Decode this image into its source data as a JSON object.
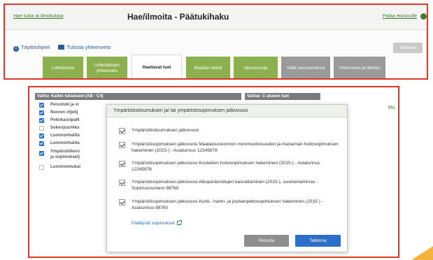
{
  "header": {
    "left_link": "Hae tukia ja ilmoituksia",
    "title": "Hae/ilmoita - Päätukihaku",
    "right_link": "Palaa etusivulle"
  },
  "toolbar": {
    "help_label": "Täyttöohjeet",
    "print_label": "Tulosta yhteenveto",
    "save_label": "Tallenna"
  },
  "tabs": [
    {
      "label": "Lohkotiedot"
    },
    {
      "label": "Lohkotietojen yhteenveto"
    },
    {
      "label": "Haettavat tuet"
    },
    {
      "label": "Maatilan tiedot"
    },
    {
      "label": "Vipuneuvoja"
    },
    {
      "label": "Vältä seuraamuksia"
    },
    {
      "label": "Yhteenveto ja lähetys"
    }
  ],
  "table": {
    "col_select": "Valitse",
    "col_all": "Kaikki tukialueet (AB - C4)",
    "col_select2": "Valitse",
    "col_c": "C-alueen tuet",
    "rows": [
      {
        "label": "Perustuki ja vi",
        "checked": true
      },
      {
        "label": "Nuoren viljelij",
        "checked": true
      },
      {
        "label": "Peltokasvipalk",
        "checked": true
      },
      {
        "label": "Sokerijuurikka",
        "checked": false
      },
      {
        "label": "Luonnonhaitta",
        "checked": true
      },
      {
        "label": "Luonnonhaitta",
        "checked": true
      },
      {
        "label": "Ympäristökorv",
        "label2": "ja sopimukset)",
        "checked": true
      },
      {
        "label": "Luonnonmukai",
        "checked": false
      }
    ],
    "right_partial": "Mu"
  },
  "modal": {
    "title": "Ympäristösitoumuksen ja/ tai ympäristösopimuksen jatkovuosi",
    "items": [
      {
        "text": "Ympäristösitoumuksen jatkovuosi"
      },
      {
        "text": "Ympäristösopimuksen jatkovuosi Maatalousluonnon monimuotoisuuden ja maiseman hoitosopimuksen hakeminen (2015-) - Asiatunnus 12345678"
      },
      {
        "text": "Ympäristösopimuksen jatkovuosi Kosteikon hoitosopimuksen hakeminen (2015-) - Asiatunnus 12345876"
      },
      {
        "text": "Ympäristösopimuksen jatkovuosi Alkuperäisrotujen kasvattaminen (2015-), suomenlammas - Sopimusnumero 98760"
      },
      {
        "text": "Ympäristösopimuksen jatkovuosi Kurki-, hanhi- ja joutsenpeltosopimuksen hakeminen (2015-) - Asiatunnus 98760"
      }
    ],
    "ended_link": "Päättyvät sopimukset",
    "cancel_label": "Peruuta",
    "save_label": "Tallenna"
  },
  "colors": {
    "border_red": "#e0362b",
    "tab_green": "#8db04f",
    "tab_gray": "#9a9a9a",
    "primary_blue": "#2d6fc8",
    "accent_orange": "#f3b33d"
  }
}
